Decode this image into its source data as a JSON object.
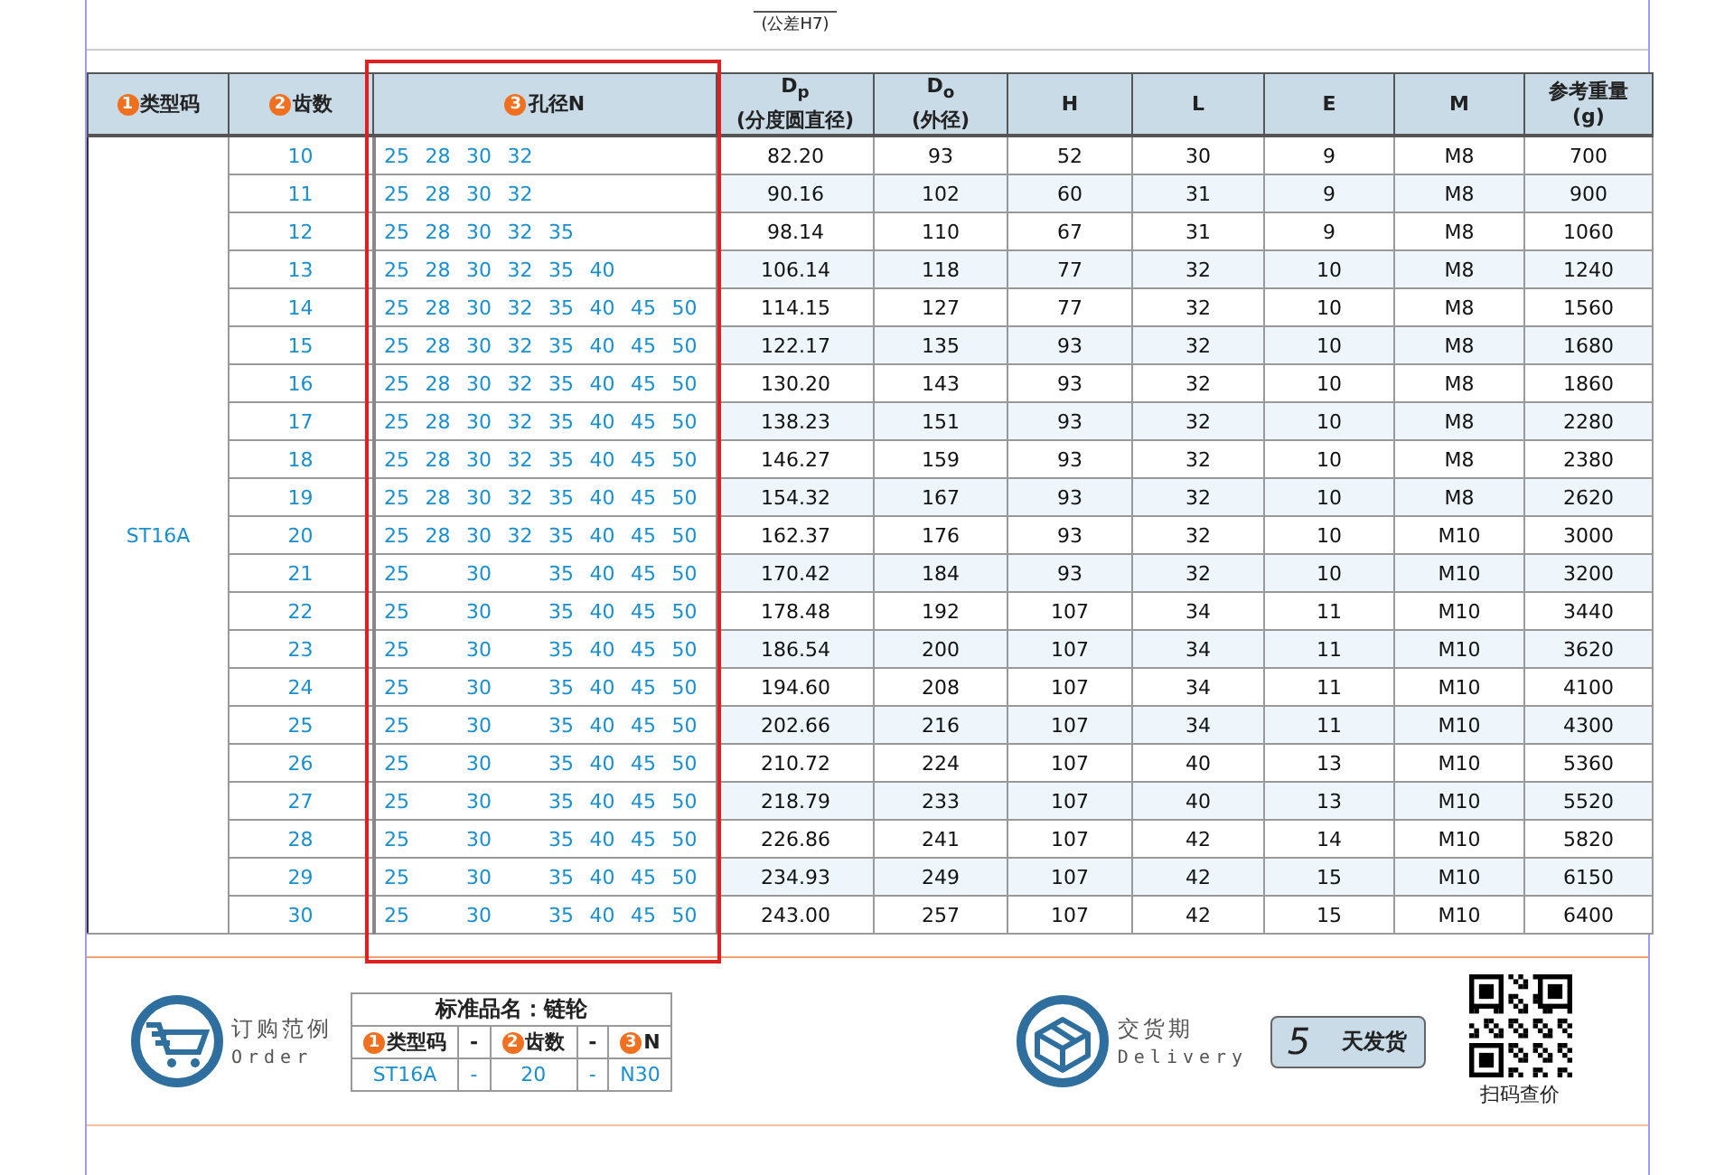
{
  "top_note": "(公差H7)",
  "table": {
    "columns": [
      {
        "num": "1",
        "label": "类型码"
      },
      {
        "num": "2",
        "label": "齿数"
      },
      {
        "num": "3",
        "label": "孔径N"
      },
      {
        "label": "D$_{p}$",
        "sub": "(分度圆直径)"
      },
      {
        "label": "D$_{o}$",
        "sub": "(外径)"
      },
      {
        "label": "H"
      },
      {
        "label": "L"
      },
      {
        "label": "E"
      },
      {
        "label": "M"
      },
      {
        "label": "参考重量",
        "sub": "(g)"
      }
    ],
    "type_code": "ST16A",
    "rows": [
      {
        "kind": "full",
        "teeth": "10",
        "bores": [
          "25",
          "28",
          "30",
          "32"
        ],
        "values": [
          "82.20",
          "93",
          "52",
          "30",
          "9",
          "M8",
          "700"
        ]
      },
      {
        "kind": "full",
        "teeth": "11",
        "bores": [
          "25",
          "28",
          "30",
          "32"
        ],
        "values": [
          "90.16",
          "102",
          "60",
          "31",
          "9",
          "M8",
          "900"
        ]
      },
      {
        "kind": "full",
        "teeth": "12",
        "bores": [
          "25",
          "28",
          "30",
          "32",
          "35"
        ],
        "values": [
          "98.14",
          "110",
          "67",
          "31",
          "9",
          "M8",
          "1060"
        ]
      },
      {
        "kind": "full",
        "teeth": "13",
        "bores": [
          "25",
          "28",
          "30",
          "32",
          "35",
          "40"
        ],
        "values": [
          "106.14",
          "118",
          "77",
          "32",
          "10",
          "M8",
          "1240"
        ]
      },
      {
        "kind": "full",
        "teeth": "14",
        "bores": [
          "25",
          "28",
          "30",
          "32",
          "35",
          "40",
          "45",
          "50"
        ],
        "values": [
          "114.15",
          "127",
          "77",
          "32",
          "10",
          "M8",
          "1560"
        ]
      },
      {
        "kind": "full",
        "teeth": "15",
        "bores": [
          "25",
          "28",
          "30",
          "32",
          "35",
          "40",
          "45",
          "50"
        ],
        "values": [
          "122.17",
          "135",
          "93",
          "32",
          "10",
          "M8",
          "1680"
        ]
      },
      {
        "kind": "full",
        "teeth": "16",
        "bores": [
          "25",
          "28",
          "30",
          "32",
          "35",
          "40",
          "45",
          "50"
        ],
        "values": [
          "130.20",
          "143",
          "93",
          "32",
          "10",
          "M8",
          "1860"
        ]
      },
      {
        "kind": "full",
        "teeth": "17",
        "bores": [
          "25",
          "28",
          "30",
          "32",
          "35",
          "40",
          "45",
          "50"
        ],
        "values": [
          "138.23",
          "151",
          "93",
          "32",
          "10",
          "M8",
          "2280"
        ]
      },
      {
        "kind": "full",
        "teeth": "18",
        "bores": [
          "25",
          "28",
          "30",
          "32",
          "35",
          "40",
          "45",
          "50"
        ],
        "values": [
          "146.27",
          "159",
          "93",
          "32",
          "10",
          "M8",
          "2380"
        ]
      },
      {
        "kind": "full",
        "teeth": "19",
        "bores": [
          "25",
          "28",
          "30",
          "32",
          "35",
          "40",
          "45",
          "50"
        ],
        "values": [
          "154.32",
          "167",
          "93",
          "32",
          "10",
          "M8",
          "2620"
        ]
      },
      {
        "kind": "full",
        "teeth": "20",
        "bores": [
          "25",
          "28",
          "30",
          "32",
          "35",
          "40",
          "45",
          "50"
        ],
        "values": [
          "162.37",
          "176",
          "93",
          "32",
          "10",
          "M10",
          "3000"
        ]
      },
      {
        "kind": "reduced",
        "teeth": "21",
        "bores": [
          "25",
          "30",
          "35",
          "40",
          "45",
          "50"
        ],
        "values": [
          "170.42",
          "184",
          "93",
          "32",
          "10",
          "M10",
          "3200"
        ]
      },
      {
        "kind": "reduced",
        "teeth": "22",
        "bores": [
          "25",
          "30",
          "35",
          "40",
          "45",
          "50"
        ],
        "values": [
          "178.48",
          "192",
          "107",
          "34",
          "11",
          "M10",
          "3440"
        ]
      },
      {
        "kind": "reduced",
        "teeth": "23",
        "bores": [
          "25",
          "30",
          "35",
          "40",
          "45",
          "50"
        ],
        "values": [
          "186.54",
          "200",
          "107",
          "34",
          "11",
          "M10",
          "3620"
        ]
      },
      {
        "kind": "reduced",
        "teeth": "24",
        "bores": [
          "25",
          "30",
          "35",
          "40",
          "45",
          "50"
        ],
        "values": [
          "194.60",
          "208",
          "107",
          "34",
          "11",
          "M10",
          "4100"
        ]
      },
      {
        "kind": "reduced",
        "teeth": "25",
        "bores": [
          "25",
          "30",
          "35",
          "40",
          "45",
          "50"
        ],
        "values": [
          "202.66",
          "216",
          "107",
          "34",
          "11",
          "M10",
          "4300"
        ]
      },
      {
        "kind": "reduced",
        "teeth": "26",
        "bores": [
          "25",
          "30",
          "35",
          "40",
          "45",
          "50"
        ],
        "values": [
          "210.72",
          "224",
          "107",
          "40",
          "13",
          "M10",
          "5360"
        ]
      },
      {
        "kind": "reduced",
        "teeth": "27",
        "bores": [
          "25",
          "30",
          "35",
          "40",
          "45",
          "50"
        ],
        "values": [
          "218.79",
          "233",
          "107",
          "40",
          "13",
          "M10",
          "5520"
        ]
      },
      {
        "kind": "reduced",
        "teeth": "28",
        "bores": [
          "25",
          "30",
          "35",
          "40",
          "45",
          "50"
        ],
        "values": [
          "226.86",
          "241",
          "107",
          "42",
          "14",
          "M10",
          "5820"
        ]
      },
      {
        "kind": "reduced",
        "teeth": "29",
        "bores": [
          "25",
          "30",
          "35",
          "40",
          "45",
          "50"
        ],
        "values": [
          "234.93",
          "249",
          "107",
          "42",
          "15",
          "M10",
          "6150"
        ]
      },
      {
        "kind": "reduced",
        "teeth": "30",
        "bores": [
          "25",
          "30",
          "35",
          "40",
          "45",
          "50"
        ],
        "values": [
          "243.00",
          "257",
          "107",
          "42",
          "15",
          "M10",
          "6400"
        ]
      }
    ]
  },
  "order": {
    "title": "订购范例",
    "subtitle": "Order",
    "example_title": "标准品名：链轮",
    "example_head": [
      {
        "num": "1",
        "label": "类型码"
      },
      {
        "label": "-"
      },
      {
        "num": "2",
        "label": "齿数"
      },
      {
        "label": "-"
      },
      {
        "num": "3",
        "label": "N"
      }
    ],
    "example_values": [
      "ST16A",
      "-",
      "20",
      "-",
      "N30"
    ]
  },
  "delivery": {
    "title": "交货期",
    "subtitle": "Delivery",
    "days": "5",
    "days_label": "天发货"
  },
  "qr": {
    "caption": "扫码查价"
  }
}
